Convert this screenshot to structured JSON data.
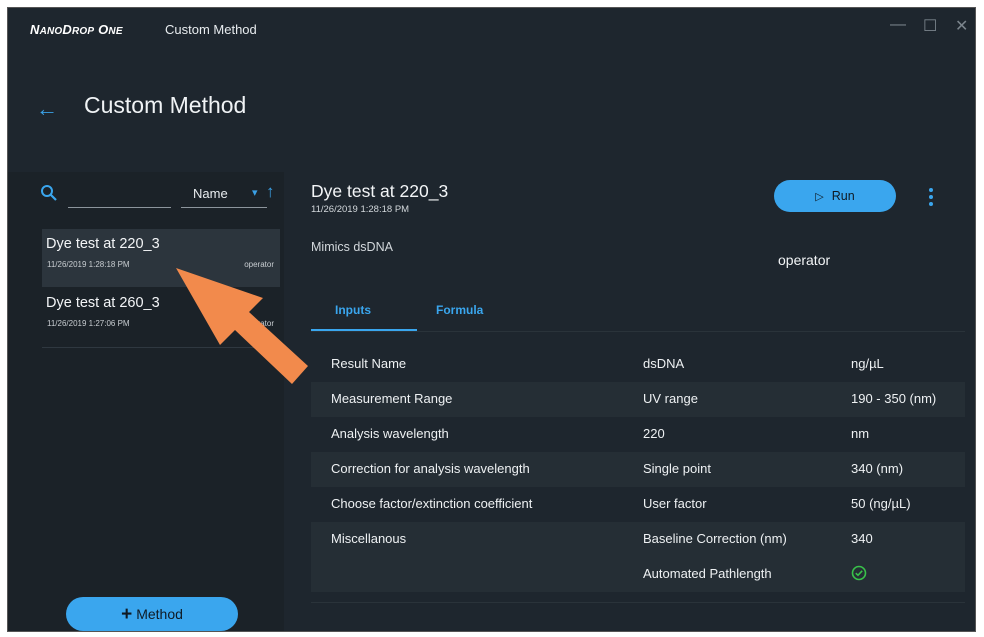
{
  "window": {
    "brand": "NanoDrop One",
    "title": "Custom Method",
    "controls": {
      "minimize": "—",
      "maximize": "☐",
      "close": "✕"
    }
  },
  "header": {
    "title": "Custom Method",
    "back_icon": "back-arrow-icon"
  },
  "sidebar": {
    "search": {
      "value": "",
      "placeholder": ""
    },
    "sort": {
      "label": "Name",
      "direction": "ascending"
    },
    "methods": [
      {
        "name": "Dye test at 220_3",
        "date": "11/26/2019 1:28:18 PM",
        "user": "operator",
        "selected": true
      },
      {
        "name": "Dye test at 260_3",
        "date": "11/26/2019 1:27:06 PM",
        "user": "operator",
        "selected": false
      }
    ],
    "add_button": {
      "label": "Method",
      "icon": "+"
    }
  },
  "detail": {
    "title": "Dye test at 220_3",
    "date": "11/26/2019 1:28:18 PM",
    "description": "Mimics dsDNA",
    "user": "operator",
    "run_label": "Run",
    "tabs": [
      {
        "label": "Inputs",
        "active": true
      },
      {
        "label": "Formula",
        "active": false
      }
    ],
    "parameters": [
      {
        "name": "Result Name",
        "value": "dsDNA",
        "unit": "ng/µL"
      },
      {
        "name": "Measurement Range",
        "value": "UV range",
        "unit": "190 - 350 (nm)"
      },
      {
        "name": "Analysis wavelength",
        "value": "220",
        "unit": "nm"
      },
      {
        "name": "Correction for analysis wavelength",
        "value": "Single point",
        "unit": "340 (nm)"
      },
      {
        "name": "Choose factor/extinction coefficient",
        "value": "User factor",
        "unit": "50 (ng/µL)"
      },
      {
        "name": "Miscellanous",
        "value": "Baseline Correction (nm)",
        "unit": "340"
      },
      {
        "name": "",
        "value": "Automated Pathlength",
        "unit": "",
        "icon": "check-circle-icon"
      }
    ]
  },
  "colors": {
    "accent": "#3aa6ee",
    "background": "#1e262e",
    "callout": "#f28a4c"
  }
}
